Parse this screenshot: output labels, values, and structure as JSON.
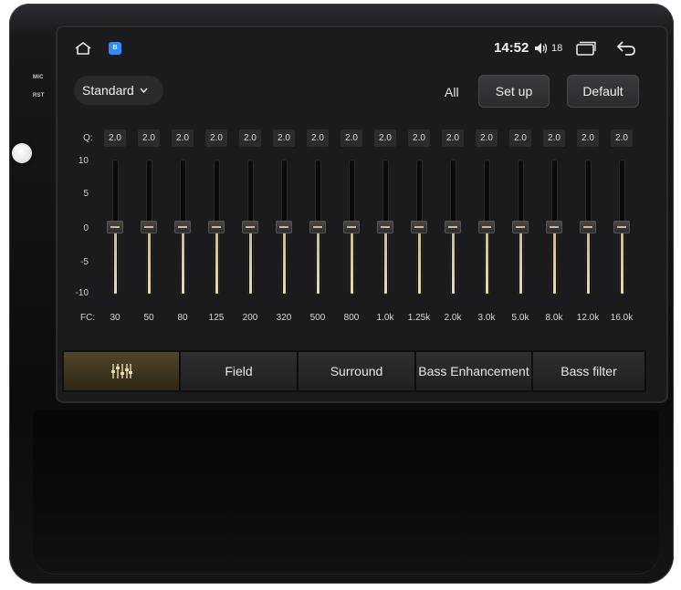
{
  "device": {
    "side_labels": [
      "MIC",
      "RST"
    ]
  },
  "statusbar": {
    "time": "14:52",
    "volume": "18",
    "icons": [
      "home-icon",
      "app-icon",
      "volume-icon",
      "recent-apps-icon",
      "back-icon"
    ]
  },
  "controls": {
    "preset_label": "Standard",
    "all_label": "All",
    "setup_label": "Set up",
    "default_label": "Default"
  },
  "eq": {
    "q_label": "Q:",
    "fc_label": "FC:",
    "db_scale": [
      "10",
      "5",
      "0",
      "-5",
      "-10"
    ],
    "bands": [
      {
        "fc": "30",
        "q": "2.0",
        "gain_db": 0
      },
      {
        "fc": "50",
        "q": "2.0",
        "gain_db": 0
      },
      {
        "fc": "80",
        "q": "2.0",
        "gain_db": 0
      },
      {
        "fc": "125",
        "q": "2.0",
        "gain_db": 0
      },
      {
        "fc": "200",
        "q": "2.0",
        "gain_db": 0
      },
      {
        "fc": "320",
        "q": "2.0",
        "gain_db": 0
      },
      {
        "fc": "500",
        "q": "2.0",
        "gain_db": 0
      },
      {
        "fc": "800",
        "q": "2.0",
        "gain_db": 0
      },
      {
        "fc": "1.0k",
        "q": "2.0",
        "gain_db": 0
      },
      {
        "fc": "1.25k",
        "q": "2.0",
        "gain_db": 0
      },
      {
        "fc": "2.0k",
        "q": "2.0",
        "gain_db": 0
      },
      {
        "fc": "3.0k",
        "q": "2.0",
        "gain_db": 0
      },
      {
        "fc": "5.0k",
        "q": "2.0",
        "gain_db": 0
      },
      {
        "fc": "8.0k",
        "q": "2.0",
        "gain_db": 0
      },
      {
        "fc": "12.0k",
        "q": "2.0",
        "gain_db": 0
      },
      {
        "fc": "16.0k",
        "q": "2.0",
        "gain_db": 0
      }
    ]
  },
  "tabs": [
    {
      "label": "",
      "icon": "equalizer-icon",
      "active": true
    },
    {
      "label": "Field",
      "active": false
    },
    {
      "label": "Surround",
      "active": false
    },
    {
      "label": "Bass Enhancement",
      "active": false
    },
    {
      "label": "Bass filter",
      "active": false
    }
  ],
  "colors": {
    "accent_gold": "#c8b98a",
    "active_tab": "#514527",
    "app_icon_blue": "#2f8cff"
  }
}
